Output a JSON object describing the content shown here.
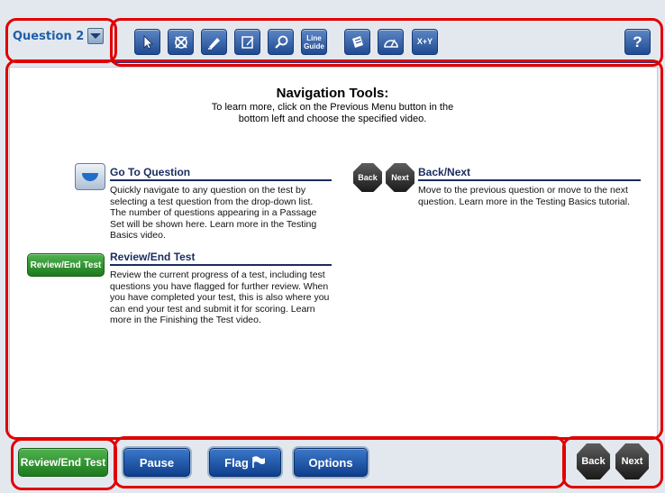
{
  "question_selector": {
    "label": "Question 2"
  },
  "toolbar": {
    "tools": [
      {
        "icon": "pointer-icon"
      },
      {
        "icon": "cross-out-icon"
      },
      {
        "icon": "highlighter-icon"
      },
      {
        "icon": "notepad-icon"
      },
      {
        "icon": "magnifier-icon"
      },
      {
        "icon": "line-guide-icon",
        "label_line1": "Line",
        "label_line2": "Guide"
      },
      {
        "icon": "scratch-paper-icon"
      },
      {
        "icon": "protractor-icon"
      },
      {
        "icon": "formula-icon",
        "label": "X+Y"
      }
    ],
    "help_label": "?"
  },
  "main": {
    "title": "Navigation Tools:",
    "subtitle": "To learn more, click on the Previous Menu button in the bottom left and choose the specified video.",
    "sections": {
      "go_to_question": {
        "heading": "Go To Question",
        "body": "Quickly navigate to any question on the test by selecting a test question from the drop-down list. The number of questions appearing in a Passage Set will be shown here. Learn more in the Testing Basics video."
      },
      "back_next": {
        "heading": "Back/Next",
        "body": "Move to the previous question or move to the next question. Learn more in the Testing Basics tutorial.",
        "back_label": "Back",
        "next_label": "Next"
      },
      "review_end": {
        "heading": "Review/End Test",
        "body": "Review the current progress of a test, including test questions you have flagged for further review. When you have completed your test, this is also where you can end your test and submit it for scoring. Learn more in the Finishing the Test video.",
        "icon_label": "Review/End Test"
      }
    }
  },
  "bottom_bar": {
    "review_end_label": "Review/End Test",
    "pause_label": "Pause",
    "flag_label": "Flag",
    "options_label": "Options",
    "back_label": "Back",
    "next_label": "Next"
  },
  "colors": {
    "highlight": "#e00000",
    "heading": "#1a2c5e",
    "button_blue": "#1f4b93",
    "button_green": "#1d7a1d"
  }
}
